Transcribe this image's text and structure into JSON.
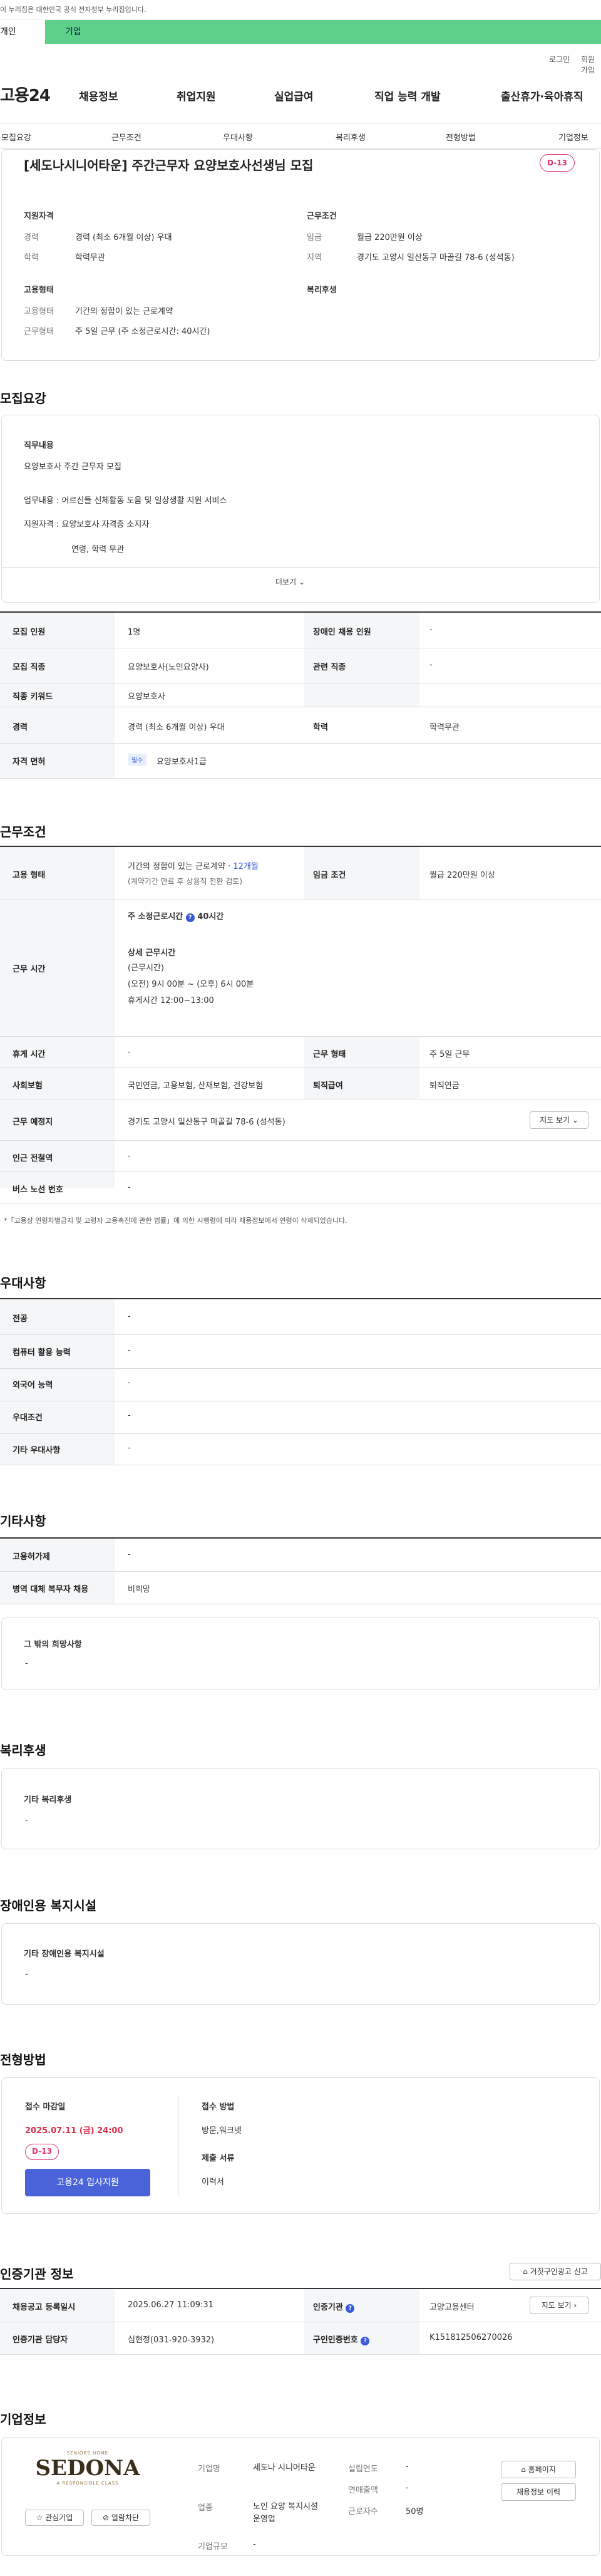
{
  "gov_notice": "이 누리집은 대한민국 공식 전자정부 누리집입니다.",
  "top_tabs": {
    "individual": "개인",
    "company": "기업"
  },
  "util": {
    "login": "로그인",
    "join": "회원가입"
  },
  "logo": "고용24",
  "gnb": [
    "채용정보",
    "취업지원",
    "실업급여",
    "직업 능력 개발",
    "출산휴가·육아휴직"
  ],
  "subnav": [
    "모집요강",
    "근무조건",
    "우대사항",
    "복리후생",
    "전형방법",
    "기업정보"
  ],
  "job": {
    "title": "[세도나시니어타운] 주간근무자 요양보호사선생님 모집",
    "dday": "D-13"
  },
  "summary": {
    "qual_head": "지원자격",
    "career_lbl": "경력",
    "career": "경력 (최소 6개월 이상) 우대",
    "edu_lbl": "학력",
    "edu": "학력무관",
    "emp_head": "고용형태",
    "emp_type_lbl": "고용형태",
    "emp_type": "기간의 정함이 있는 근로계약",
    "work_form_lbl": "근무형태",
    "work_form": "주 5일 근무 (주 소정근로시간: 40시간)",
    "cond_head": "근무조건",
    "wage_lbl": "임금",
    "wage": "월급 220만원 이상",
    "area_lbl": "지역",
    "area": "경기도 고양시 일산동구 마골길 78-6 (성석동)",
    "welfare_head": "복리후생"
  },
  "recruit": {
    "heading": "모집요강",
    "duty_head": "직무내용",
    "lines": [
      "요양보호사 주간 근무자 모집",
      "업무내용 : 어르신들 신체활동 도움 및 일상생활 지원 서비스",
      "지원자격 : 요양보호사 자격증 소지자",
      "연령, 학력 무관"
    ],
    "more": "더보기"
  },
  "recruit_table": {
    "headcount_lbl": "모집 인원",
    "headcount": "1명",
    "disabled_lbl": "장애인 채용 인원",
    "disabled": "-",
    "job_lbl": "모집 직종",
    "job": "요양보호사(노인요양사)",
    "related_lbl": "관련 직종",
    "related": "-",
    "keyword_lbl": "직종 키워드",
    "keyword": "요양보호사",
    "career_lbl": "경력",
    "career": "경력 (최소 6개월 이상) 우대",
    "edu_lbl": "학력",
    "edu": "학력무관",
    "license_lbl": "자격 면허",
    "license_badge": "필수",
    "license": "요양보호사1급"
  },
  "work": {
    "heading": "근무조건",
    "emp_lbl": "고용 형태",
    "emp_a": "기간의 정함이 있는 근로계약 ·",
    "emp_months": "12개월",
    "emp_b": "(계약기간 만료 후 상용직 전환 검토)",
    "wage_lbl": "임금 조건",
    "wage": "월급 220만원 이상",
    "hours_lbl": "근무 시간",
    "hours_total": "주 소정근로시간",
    "hours_val": "40시간",
    "detail_head": "상세 근무시간",
    "detail_lines": [
      "(근무시간)",
      "(오전) 9시 00분 ~ (오후) 6시 00분",
      "휴게시간 12:00~13:00"
    ],
    "break_lbl": "휴게 시간",
    "break": "-",
    "form_lbl": "근무 형태",
    "form": "주 5일 근무",
    "ins_lbl": "사회보험",
    "ins": "국민연금, 고용보험, 산재보험, 건강보험",
    "sev_lbl": "퇴직급여",
    "sev": "퇴직연금",
    "place_lbl": "근무 예정지",
    "place": "경기도 고양시 일산동구 마골길 78-6 (성석동)",
    "map_btn": "지도 보기",
    "station_lbl": "인근 전철역",
    "station": "-",
    "bus_lbl": "버스 노선 번호",
    "bus": "-",
    "note": "*「고용상 연령차별금지 및 고령자 고용촉진에 관한 법률」에 의한 시행령에 따라 채용정보에서 연령이 삭제되었습니다."
  },
  "pref": {
    "heading": "우대사항",
    "rows": [
      [
        "전공",
        "-"
      ],
      [
        "컴퓨터 활용 능력",
        "-"
      ],
      [
        "외국어 능력",
        "-"
      ],
      [
        "우대조건",
        "-"
      ],
      [
        "기타 우대사항",
        "-"
      ]
    ]
  },
  "etc": {
    "heading": "기타사항",
    "rows": [
      [
        "고용허가제",
        "-"
      ],
      [
        "병역 대체 복무자 채용",
        "비희망"
      ]
    ],
    "other_head": "그 밖의 희망사항",
    "other": "-"
  },
  "welfare": {
    "heading": "복리후생",
    "sub": "기타 복리후생",
    "val": "-"
  },
  "facility": {
    "heading": "장애인용 복지시설",
    "sub": "기타 장애인용 복지시설",
    "val": "-"
  },
  "process": {
    "heading": "전형방법",
    "deadline_lbl": "접수 마감일",
    "deadline": "2025.07.11 (금) 24:00",
    "dday": "D-13",
    "apply_btn": "고용24 입사지원",
    "method_lbl": "접수 방법",
    "method": "방문,워크넷",
    "docs_lbl": "제출 서류",
    "docs": "이력서"
  },
  "agency": {
    "heading": "인증기관 정보",
    "report_btn": "거짓구인광고 신고",
    "reg_lbl": "채용공고 등록일시",
    "reg": "2025.06.27 11:09:31",
    "agency_lbl": "인증기관",
    "agency": "고양고용센터",
    "map_btn": "지도 보기",
    "mgr_lbl": "인증기관 담당자",
    "mgr": "심현정(031-920-3932)",
    "no_lbl": "구인인증번호",
    "no": "K151812506270026"
  },
  "company": {
    "heading": "기업정보",
    "logo_top": "SENIORS HOME",
    "logo_main": "SEDONA",
    "logo_sub": "A RESPONSIBLE CLASS",
    "fav_btn": "관심기업",
    "block_btn": "열람차단",
    "name_lbl": "기업명",
    "name": "세도나 시니어타운",
    "ind_lbl": "업종",
    "ind": "노인 요양 복지시설 운영업",
    "size_lbl": "기업규모",
    "size": "-",
    "est_lbl": "설립연도",
    "est": "-",
    "rev_lbl": "연매출액",
    "rev": "-",
    "emp_lbl": "근로자수",
    "emp": "50명",
    "home_btn": "홈페이지",
    "jobs_btn": "채용정보 이력"
  },
  "colors": {
    "green": "#5ed08a",
    "red": "#e2356b",
    "primary": "#4a63d8"
  }
}
